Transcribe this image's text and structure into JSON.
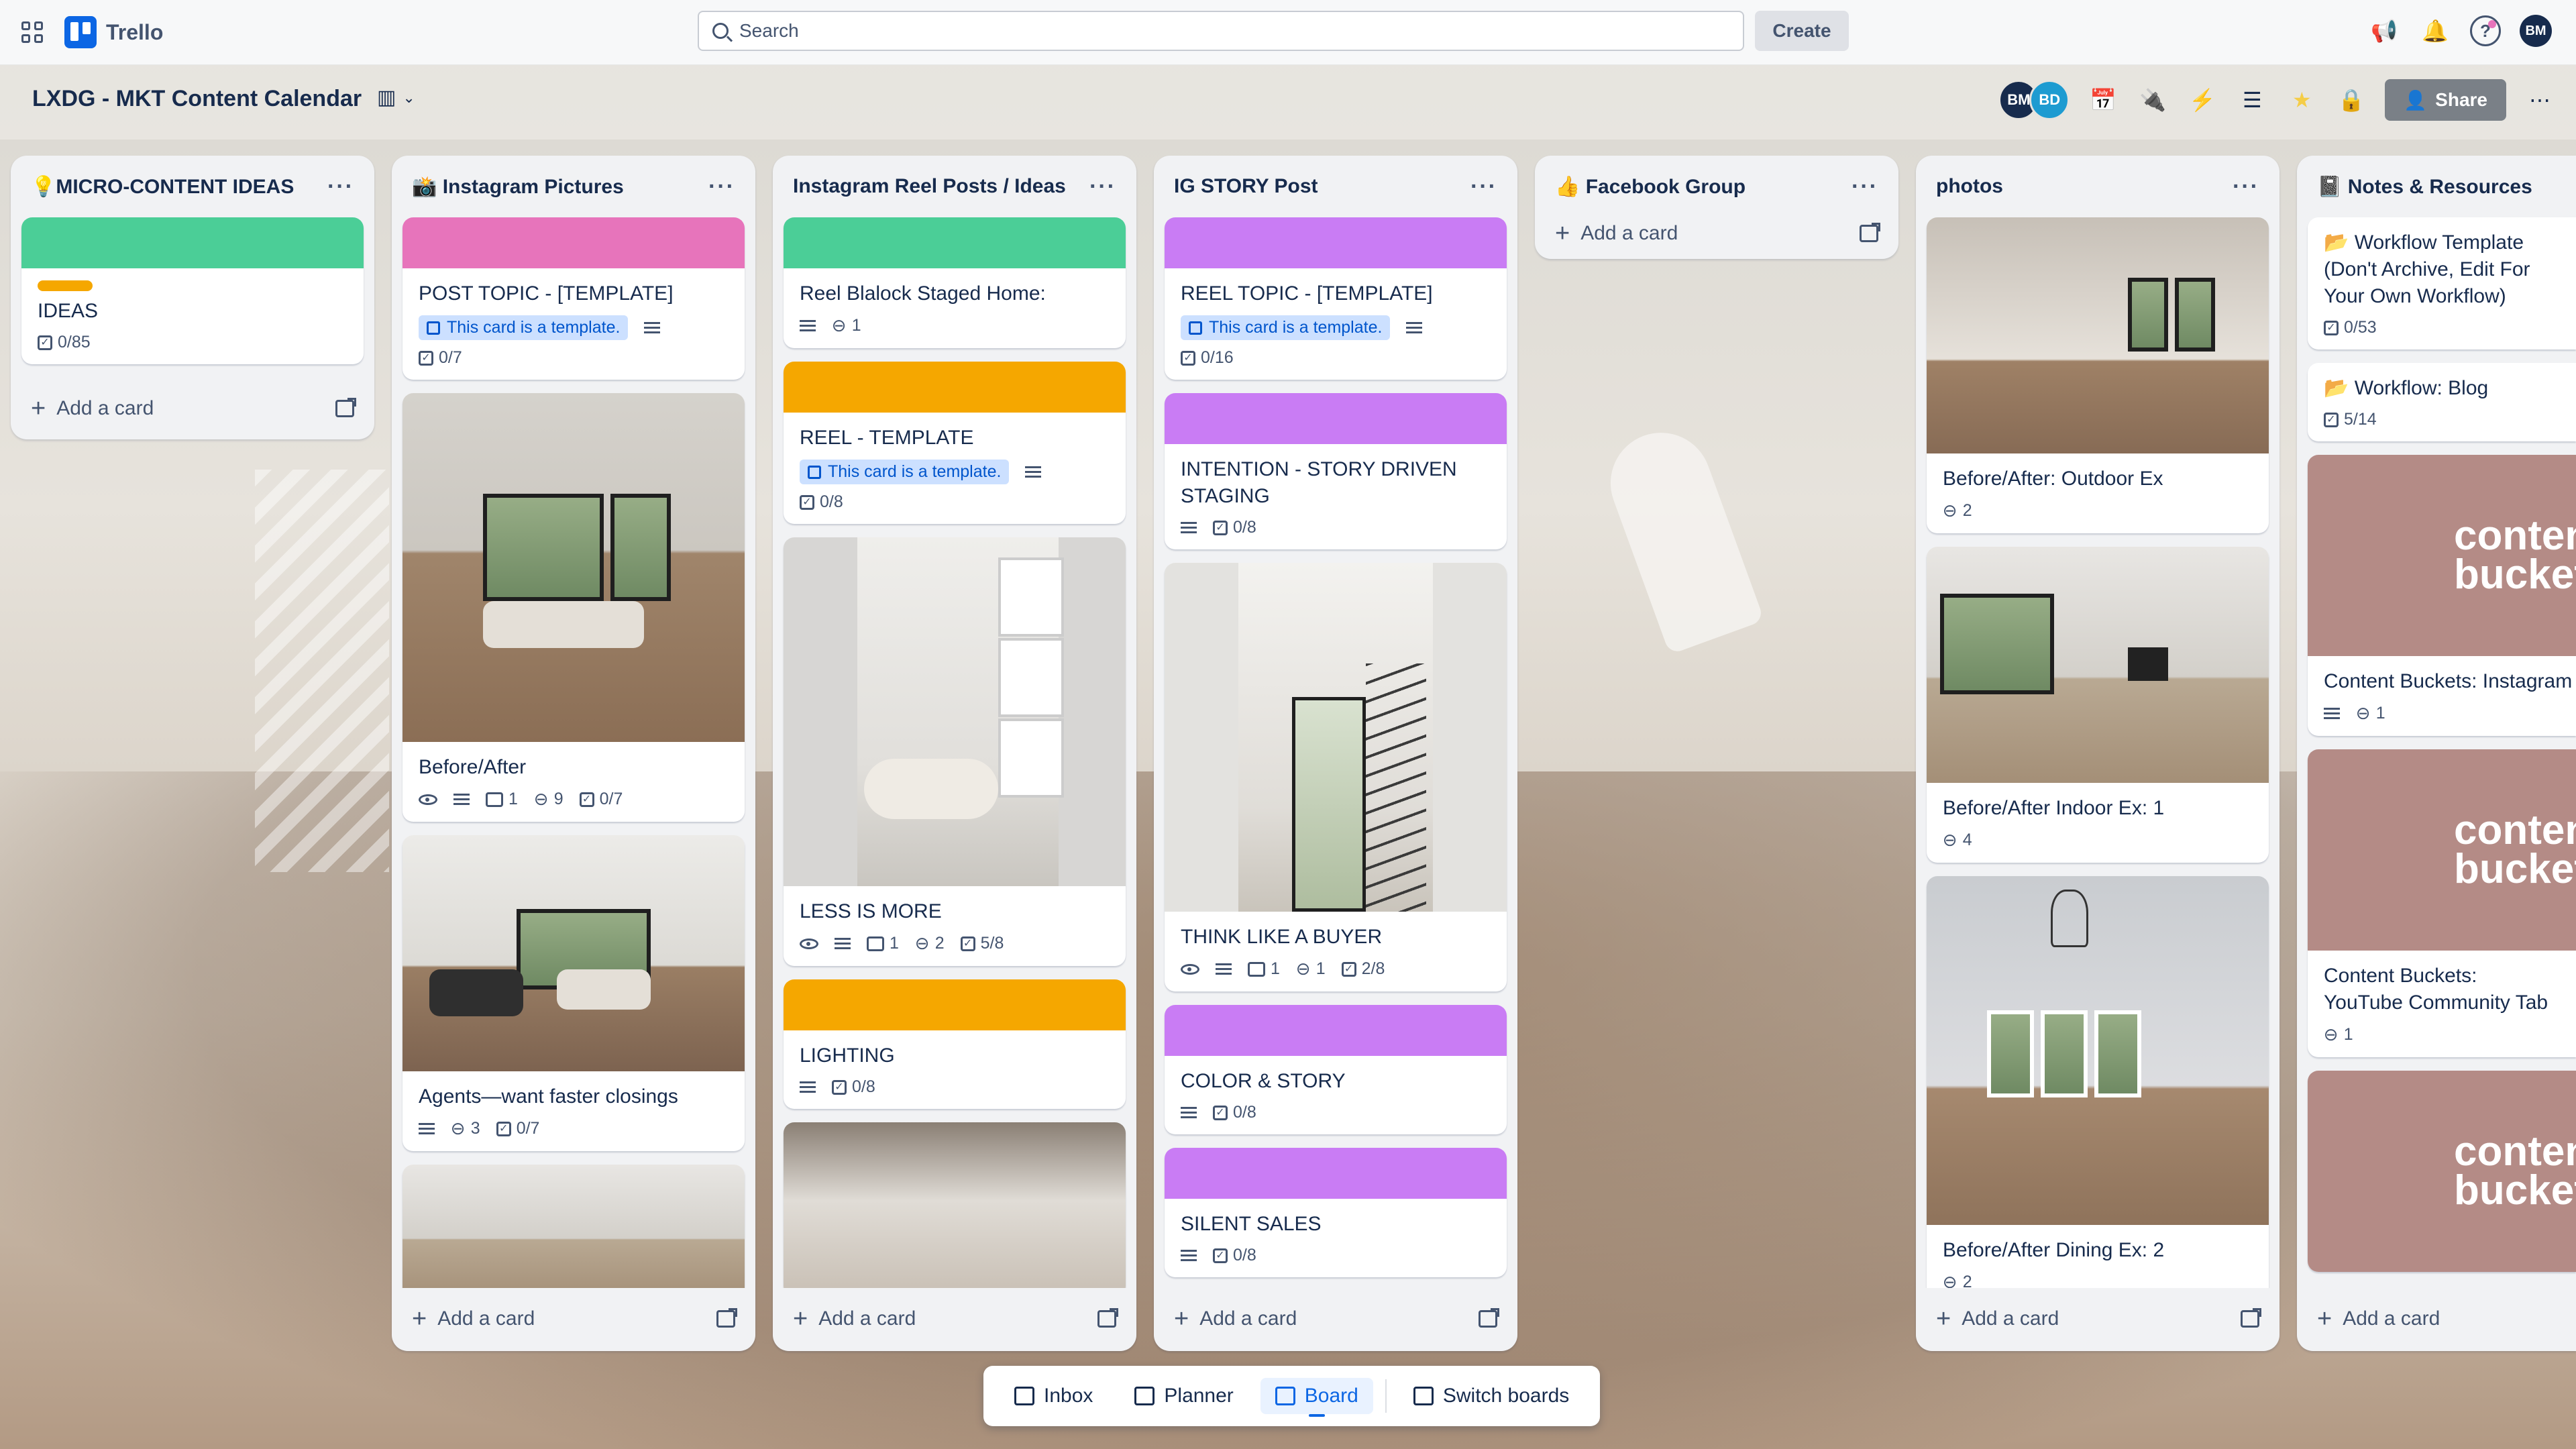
{
  "app": {
    "name": "Trello"
  },
  "search": {
    "placeholder": "Search"
  },
  "topbar": {
    "create_label": "Create",
    "user_initials": "BM"
  },
  "board": {
    "title": "LXDG - MKT Content Calendar",
    "members": [
      {
        "initials": "BM",
        "color": "#172b4d"
      },
      {
        "initials": "BD",
        "color": "#1d9bd1"
      }
    ],
    "share_label": "Share",
    "starred_color": "#f5cd47"
  },
  "colors": {
    "green": "#4bce97",
    "pink": "#e774bb",
    "orange": "#f5a700",
    "purple": "#c97cf4",
    "accent": "#0c66e4"
  },
  "lists": [
    {
      "title": "💡MICRO-CONTENT IDEAS",
      "add_label": "Add a card",
      "cards": [
        {
          "title": "IDEAS",
          "checklist": "0/85"
        }
      ]
    },
    {
      "title": "📸 Instagram Pictures",
      "add_label": "Add a card",
      "cards": [
        {
          "title": "POST TOPIC - [TEMPLATE]",
          "template_text": "This card is a template.",
          "checklist": "0/7"
        },
        {
          "title": "Before/After",
          "comments": "1",
          "attachments": "9",
          "checklist": "0/7"
        },
        {
          "title": "Agents—want faster closings",
          "attachments": "3",
          "checklist": "0/7"
        }
      ]
    },
    {
      "title": "Instagram Reel Posts / Ideas",
      "add_label": "Add a card",
      "cards": [
        {
          "title": "Reel Blalock Staged Home:",
          "attachments": "1"
        },
        {
          "title": "REEL - TEMPLATE",
          "template_text": "This card is a template.",
          "checklist": "0/8"
        },
        {
          "title": "LESS IS MORE",
          "comments": "1",
          "attachments": "2",
          "checklist": "5/8"
        },
        {
          "title": "LIGHTING",
          "checklist": "0/8"
        }
      ]
    },
    {
      "title": "IG STORY Post",
      "add_label": "Add a card",
      "cards": [
        {
          "title": "REEL TOPIC - [TEMPLATE]",
          "template_text": "This card is a template.",
          "checklist": "0/16"
        },
        {
          "title": "INTENTION - STORY DRIVEN STAGING",
          "checklist": "0/8"
        },
        {
          "title": "THINK LIKE A BUYER",
          "comments": "1",
          "attachments": "1",
          "checklist": "2/8"
        },
        {
          "title": "COLOR & STORY",
          "checklist": "0/8"
        },
        {
          "title": "SILENT SALES",
          "checklist": "0/8"
        }
      ]
    },
    {
      "title": "👍 Facebook Group",
      "add_label": "Add a card",
      "cards": []
    },
    {
      "title": "photos",
      "add_label": "Add a card",
      "cards": [
        {
          "title": "Before/After: Outdoor Ex",
          "attachments": "2"
        },
        {
          "title": "Before/After Indoor Ex: 1",
          "attachments": "4"
        },
        {
          "title": "Before/After Dining Ex: 2",
          "attachments": "2"
        }
      ]
    },
    {
      "title": "📓 Notes & Resources",
      "add_label": "Add a card",
      "cards": [
        {
          "title": "📂 Workflow Template (Don't Archive, Edit For Your Own Workflow)",
          "checklist": "0/53"
        },
        {
          "title": "📂 Workflow: Blog",
          "checklist": "5/14"
        },
        {
          "cover_text": "content buckets",
          "title": "Content Buckets: Instagram",
          "attachments": "1"
        },
        {
          "cover_text": "content buckets",
          "title": "Content Buckets: YouTube Community Tab",
          "attachments": "1"
        },
        {
          "cover_text": "content buckets"
        }
      ]
    }
  ],
  "bottom_nav": {
    "inbox": "Inbox",
    "planner": "Planner",
    "board": "Board",
    "switch": "Switch boards"
  }
}
